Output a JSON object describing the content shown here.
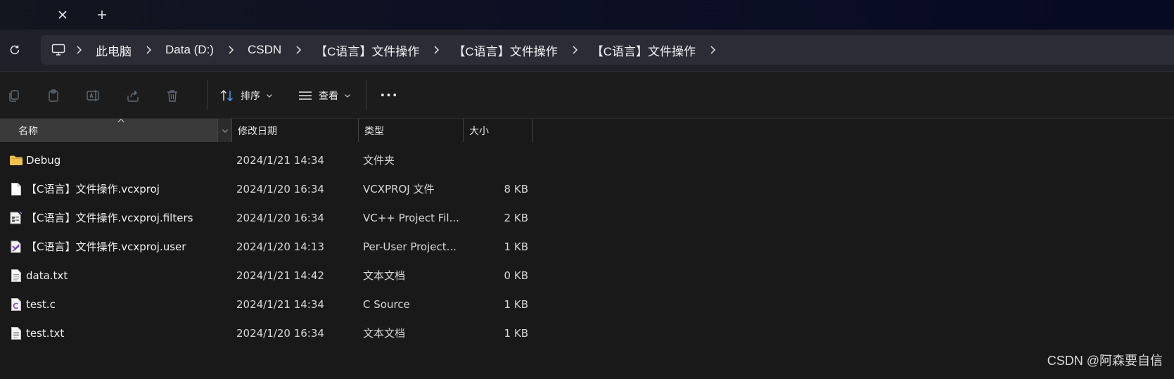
{
  "tabs": {
    "close_label": "✕",
    "new_label": "+"
  },
  "address": {
    "crumbs": [
      "此电脑",
      "Data (D:)",
      "CSDN",
      "【C语言】文件操作",
      "【C语言】文件操作",
      "【C语言】文件操作"
    ]
  },
  "commandbar": {
    "sort_label": "排序",
    "view_label": "查看",
    "more_label": "•••",
    "buttons": [
      "copy-icon",
      "paste-icon",
      "rename-icon",
      "share-icon",
      "delete-icon"
    ]
  },
  "columns": {
    "name": "名称",
    "date": "修改日期",
    "type": "类型",
    "size": "大小"
  },
  "files": [
    {
      "icon": "folder-icon",
      "name": "Debug",
      "date": "2024/1/21 14:34",
      "type": "文件夹",
      "size": ""
    },
    {
      "icon": "file-icon",
      "name": "【C语言】文件操作.vcxproj",
      "date": "2024/1/20 16:34",
      "type": "VCXPROJ 文件",
      "size": "8 KB"
    },
    {
      "icon": "filters-file-icon",
      "name": "【C语言】文件操作.vcxproj.filters",
      "date": "2024/1/20 16:34",
      "type": "VC++ Project Fil...",
      "size": "2 KB"
    },
    {
      "icon": "vs-user-file-icon",
      "name": "【C语言】文件操作.vcxproj.user",
      "date": "2024/1/20 14:13",
      "type": "Per-User Project...",
      "size": "1 KB"
    },
    {
      "icon": "text-file-icon",
      "name": "data.txt",
      "date": "2024/1/21 14:42",
      "type": "文本文档",
      "size": "0 KB"
    },
    {
      "icon": "c-source-icon",
      "name": "test.c",
      "date": "2024/1/21 14:34",
      "type": "C Source",
      "size": "1 KB"
    },
    {
      "icon": "text-file-icon",
      "name": "test.txt",
      "date": "2024/1/20 16:34",
      "type": "文本文档",
      "size": "1 KB"
    }
  ],
  "watermark": "CSDN @阿森要自信",
  "colors": {
    "background": "#191919",
    "addressbar": "#2b2c36",
    "folder": "#f2c14e",
    "accent_blue": "#4ea1ff"
  }
}
